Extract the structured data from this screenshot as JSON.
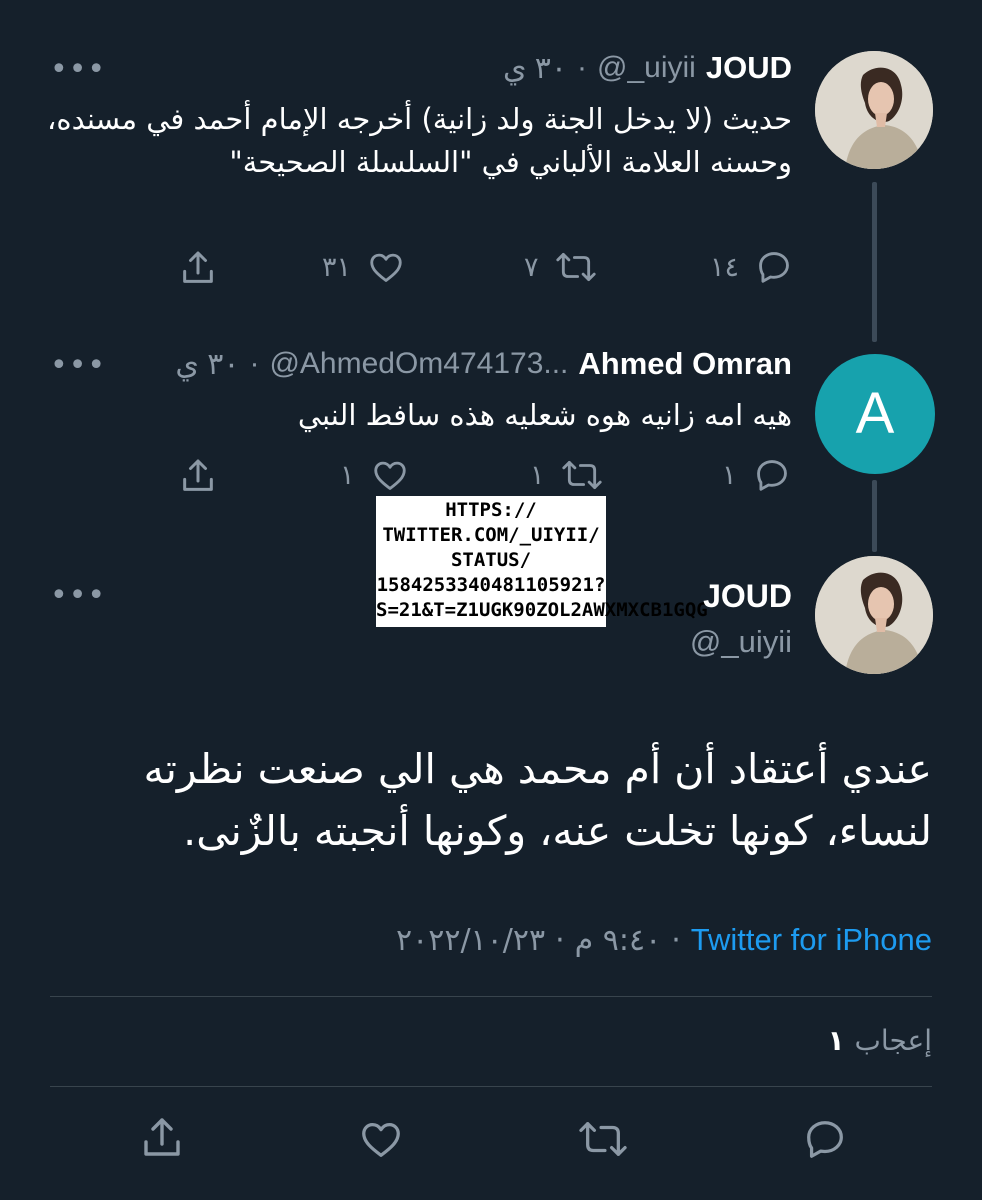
{
  "tweet1": {
    "name": "JOUD",
    "handle": "@_uiyii",
    "separator": "·",
    "time": "٣٠ ي",
    "more": "•••",
    "text": "حديث (لا يدخل الجنة ولد زانية) أخرجه الإمام أحمد في مسنده، وحسنه العلامة الألباني في \"السلسلة الصحيحة\"",
    "reply_count": "١٤",
    "retweet_count": "٧",
    "like_count": "٣١"
  },
  "tweet2": {
    "name": "Ahmed Omran",
    "handle": "@AhmedOm474173...",
    "separator": "·",
    "time": "٣٠ ي",
    "more": "•••",
    "avatar_letter": "A",
    "avatar_color": "#17a2ad",
    "text": "هيه امه زانيه هوه شعليه هذه سافط النبي",
    "reply_count": "١",
    "retweet_count": "١",
    "like_count": "١"
  },
  "overlay": {
    "text": "HTTPS://\nTWITTER.COM/_UIYII/\nSTATUS/\n1584253340481105921?\nS=21&T=Z1UGK90ZOL2AWXMXCB1GQG"
  },
  "main": {
    "name": "JOUD",
    "handle": "@_uiyii",
    "more": "•••",
    "text": "عندي أعتقاد أن أم محمد هي الي صنعت نظرته لنساء، كونها تخلت عنه، وكونها أنجبته بالزٌنى.",
    "date": "٢٠٢٢/١٠/٢٣",
    "time": "٩:٤٠ م",
    "separator": "·",
    "source": "Twitter for iPhone",
    "likes_count": "١",
    "likes_label": "إعجاب"
  },
  "icons": {
    "reply": "reply-icon",
    "retweet": "retweet-icon",
    "like": "heart-icon",
    "share": "share-icon"
  },
  "colors": {
    "background": "#15202b",
    "secondary_text": "#8b98a5",
    "link": "#1d9bf0",
    "divider": "#38444d"
  }
}
